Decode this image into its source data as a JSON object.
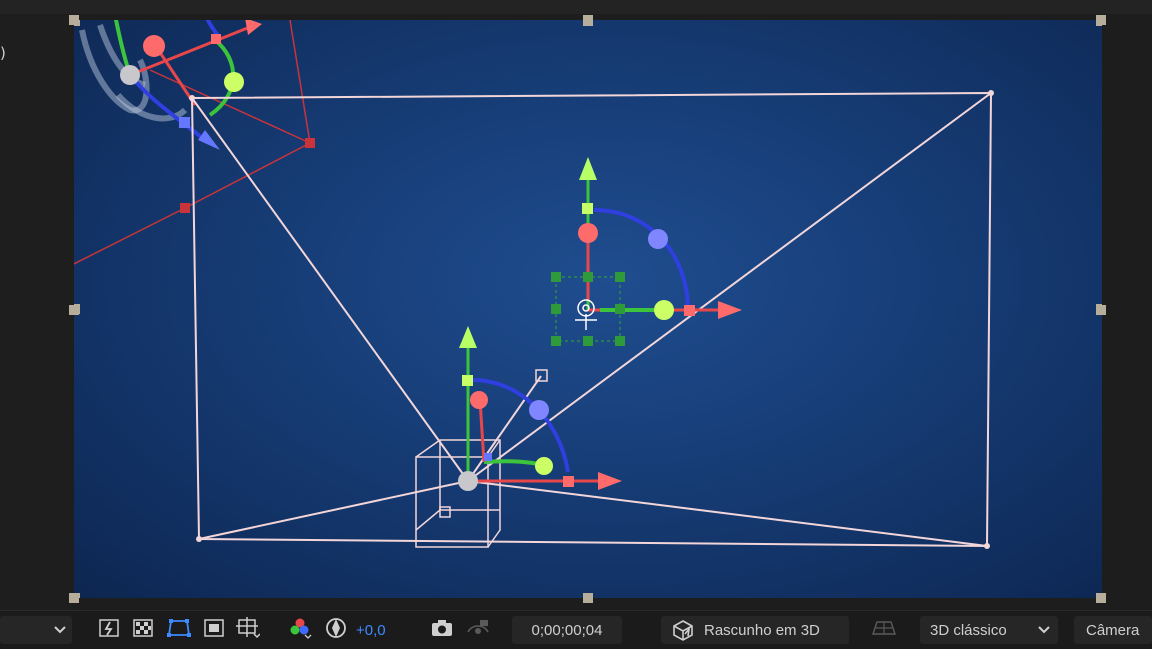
{
  "left_panel": {
    "fragment_text": ")"
  },
  "toolbar": {
    "magnification_value": "",
    "exposure_value": "+0,0",
    "timecode": "0;00;00;04",
    "renderer_label": "Rascunho em 3D",
    "view_layout_label": "3D clássico",
    "active_camera_label": "Câmera"
  },
  "colors": {
    "viewport_bg": "#163c75",
    "axis_x": "#e8474a",
    "axis_y": "#3cc43c",
    "axis_z": "#2f3fe0",
    "camera_wire": "#f3d6d9",
    "handle": "#b7ad9b",
    "accent_blue": "#3d8bff"
  },
  "icons": [
    "fast-preview-icon",
    "transparency-grid-icon",
    "mask-visibility-icon",
    "region-of-interest-icon",
    "guides-icon",
    "rgb-channels-icon",
    "exposure-reset-icon",
    "snapshot-icon",
    "show-snapshot-icon",
    "draft-3d-icon",
    "ground-plane-icon",
    "chevron-down-icon"
  ]
}
